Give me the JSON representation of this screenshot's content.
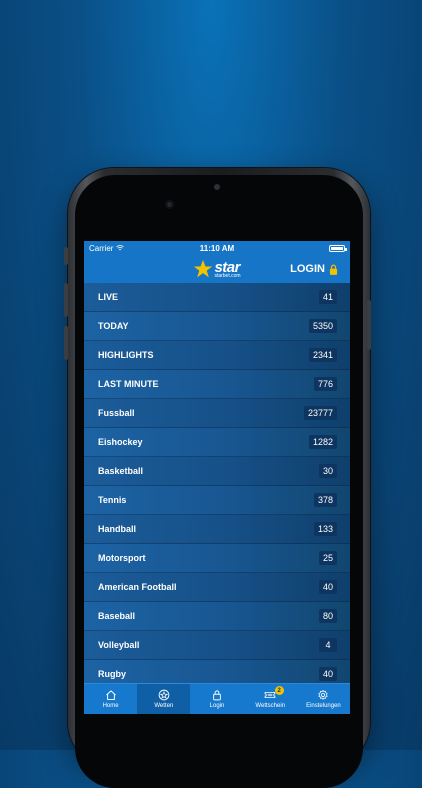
{
  "status_bar": {
    "carrier": "Carrier",
    "time": "11:10 AM"
  },
  "header": {
    "logo": {
      "word": "star",
      "sub": "starbet.com"
    },
    "login_label": "LOGIN"
  },
  "sports_list": [
    {
      "label": "LIVE",
      "count": "41"
    },
    {
      "label": "TODAY",
      "count": "5350"
    },
    {
      "label": "HIGHLIGHTS",
      "count": "2341"
    },
    {
      "label": "LAST MINUTE",
      "count": "776"
    },
    {
      "label": "Fussball",
      "count": "23777"
    },
    {
      "label": "Eishockey",
      "count": "1282"
    },
    {
      "label": "Basketball",
      "count": "30"
    },
    {
      "label": "Tennis",
      "count": "378"
    },
    {
      "label": "Handball",
      "count": "133"
    },
    {
      "label": "Motorsport",
      "count": "25"
    },
    {
      "label": "American Football",
      "count": "40"
    },
    {
      "label": "Baseball",
      "count": "80"
    },
    {
      "label": "Volleyball",
      "count": "4"
    },
    {
      "label": "Rugby",
      "count": "40"
    }
  ],
  "tab_bar": {
    "tabs": [
      {
        "label": "Home",
        "icon": "home-icon"
      },
      {
        "label": "Wetten",
        "icon": "star-circle-icon",
        "active": true
      },
      {
        "label": "Login",
        "icon": "lock-icon"
      },
      {
        "label": "Wettschein",
        "icon": "ticket-icon",
        "badge": "2"
      },
      {
        "label": "Einstelungen",
        "icon": "gear-icon"
      }
    ]
  },
  "colors": {
    "brand_blue": "#1675c6",
    "accent_yellow": "#f2c200",
    "list_bg": "#165087"
  }
}
